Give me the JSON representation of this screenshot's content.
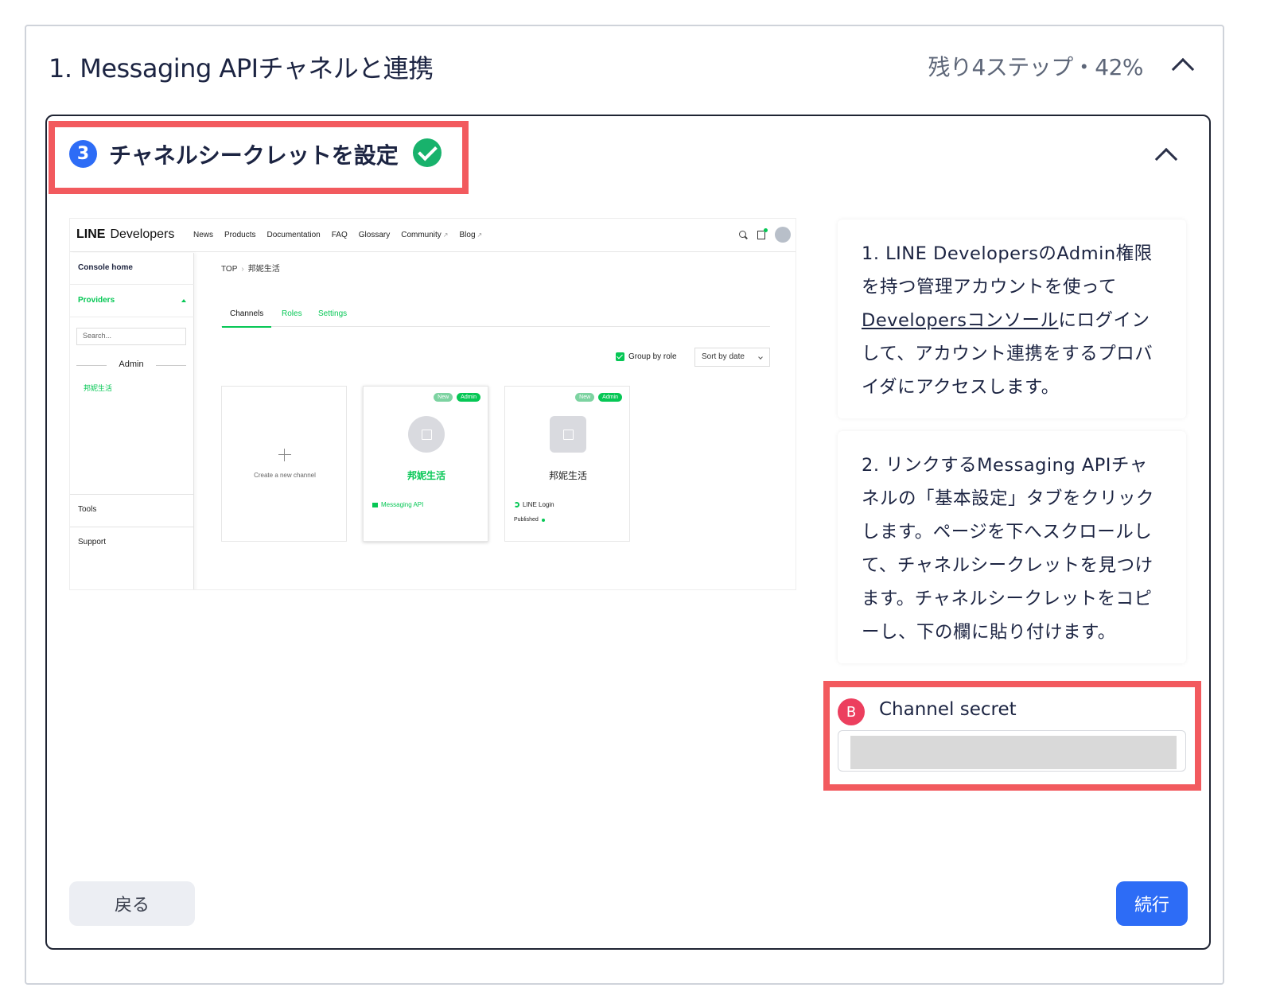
{
  "section": {
    "title": "1. Messaging APIチャネルと連携",
    "progress": "残り4ステップ・42%"
  },
  "step": {
    "number": "3",
    "title": "チャネルシークレットを設定",
    "status_icon": "check-circle-icon"
  },
  "screenshot": {
    "logo_bold": "LINE",
    "logo_rest": "Developers",
    "nav": [
      "News",
      "Products",
      "Documentation",
      "FAQ",
      "Glossary",
      "Community",
      "Blog"
    ],
    "sidebar": {
      "console_home": "Console home",
      "providers": "Providers",
      "search_placeholder": "Search...",
      "admin": "Admin",
      "provider_name": "邦妮生活",
      "tools": "Tools",
      "support": "Support"
    },
    "breadcrumb": [
      "TOP",
      "邦妮生活"
    ],
    "tabs": [
      "Channels",
      "Roles",
      "Settings"
    ],
    "group_by_role": "Group by role",
    "sort": "Sort by date",
    "create_channel": "Create a new channel",
    "cards": [
      {
        "badge_new": "New",
        "badge_admin": "Admin",
        "name": "邦妮生活",
        "type": "Messaging API"
      },
      {
        "badge_new": "New",
        "badge_admin": "Admin",
        "name": "邦妮生活",
        "type": "LINE Login",
        "status": "Published"
      }
    ],
    "accent_color": "#06c755"
  },
  "instructions": {
    "step1_pre": "1. LINE DevelopersのAdmin権限を持つ管理アカウントを使って",
    "step1_link": "Developersコンソール",
    "step1_post": "にログインして、アカウント連携をするプロバイダにアクセスします。",
    "step2": "2. リンクするMessaging APIチャネルの「基本設定」タブをクリックします。ページを下へスクロールして、チャネルシークレットを見つけます。チャネルシークレットをコピーし、下の欄に貼り付けます。"
  },
  "secret": {
    "badge": "B",
    "label": "Channel secret",
    "value": ""
  },
  "buttons": {
    "back": "戻る",
    "next": "続行"
  },
  "colors": {
    "primary": "#2d6cf6",
    "success": "#18b26c",
    "highlight": "#f25a5e",
    "badge": "#ec3f5e"
  }
}
